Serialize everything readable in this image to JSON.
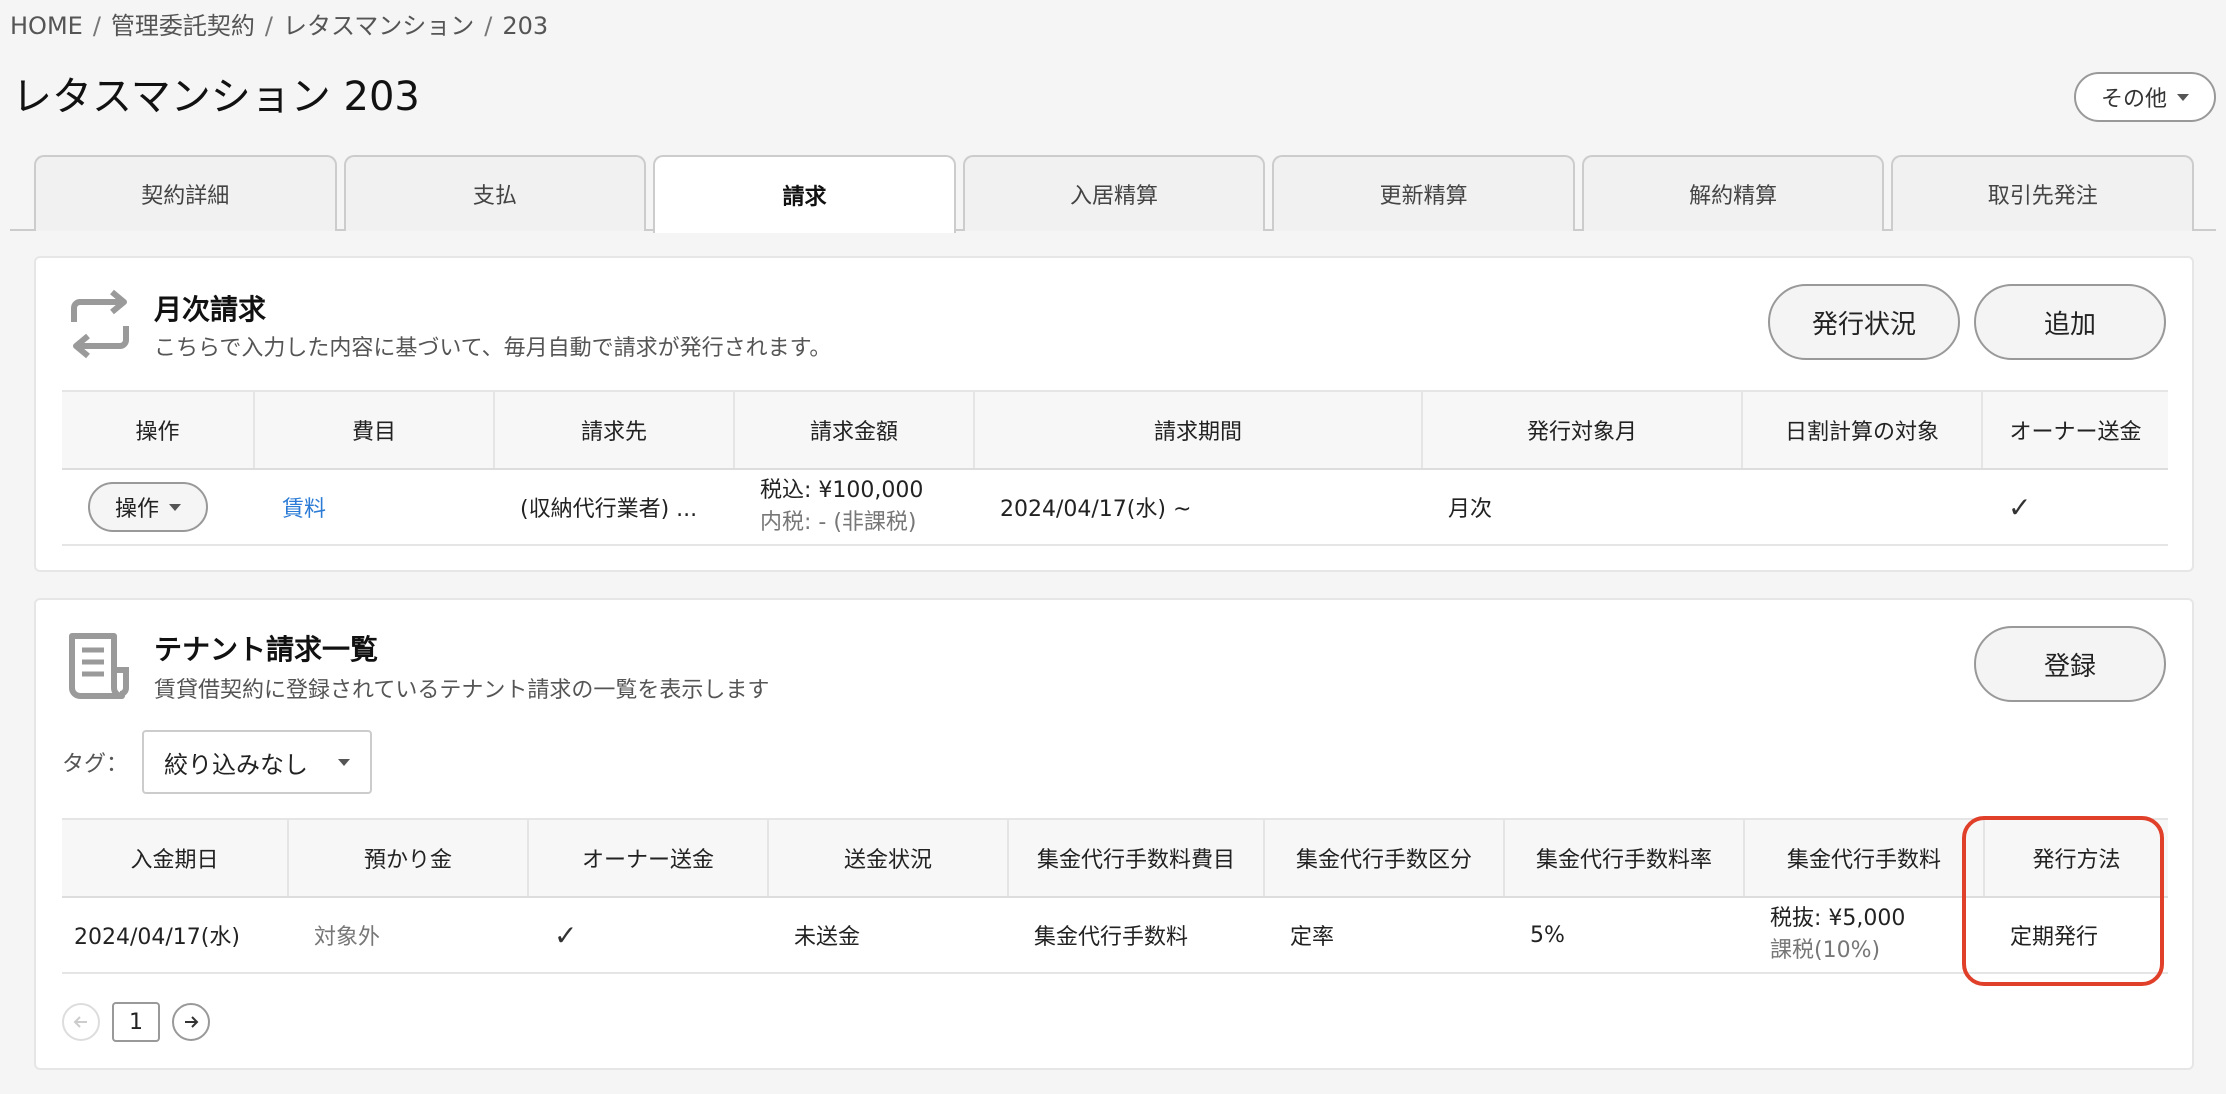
{
  "breadcrumb": {
    "items": [
      "HOME",
      "管理委託契約",
      "レタスマンション",
      "203"
    ],
    "separator": "/"
  },
  "page": {
    "title": "レタスマンション 203",
    "more_button": "その他"
  },
  "tabs": [
    {
      "label": "契約詳細",
      "active": false
    },
    {
      "label": "支払",
      "active": false
    },
    {
      "label": "請求",
      "active": true
    },
    {
      "label": "入居精算",
      "active": false
    },
    {
      "label": "更新精算",
      "active": false
    },
    {
      "label": "解約精算",
      "active": false
    },
    {
      "label": "取引先発注",
      "active": false
    }
  ],
  "monthly": {
    "icon": "repeat-icon",
    "title": "月次請求",
    "description": "こちらで入力した内容に基づいて、毎月自動で請求が発行されます。",
    "status_button": "発行状況",
    "add_button": "追加",
    "columns": [
      "操作",
      "費目",
      "請求先",
      "請求金額",
      "請求期間",
      "発行対象月",
      "日割計算の対象",
      "オーナー送金"
    ],
    "rows": [
      {
        "action": "操作",
        "item": "賃料",
        "billing_to": "(収納代行業者) ...",
        "amount_main": "税込: ¥100,000",
        "amount_sub": "内税: - (非課税)",
        "period": "2024/04/17(水) ~",
        "target_month": "月次",
        "prorated": "",
        "owner_remit": "✓"
      }
    ]
  },
  "tenant": {
    "icon": "document-icon",
    "title": "テナント請求一覧",
    "description": "賃貸借契約に登録されているテナント請求の一覧を表示します",
    "register_button": "登録",
    "tag_label": "タグ：",
    "tag_select": "絞り込みなし",
    "columns": [
      "入金期日",
      "預かり金",
      "オーナー送金",
      "送金状況",
      "集金代行手数料費目",
      "集金代行手数区分",
      "集金代行手数料率",
      "集金代行手数料",
      "発行方法"
    ],
    "rows": [
      {
        "due_date": "2024/04/17(水)",
        "deposit": "対象外",
        "owner_remit": "✓",
        "remit_status": "未送金",
        "fee_item": "集金代行手数料",
        "fee_type": "定率",
        "fee_rate": "5%",
        "fee_main": "税抜: ¥5,000",
        "fee_sub": "課税(10%)",
        "issue_method": "定期発行"
      }
    ],
    "pager": {
      "current": "1"
    }
  },
  "colors": {
    "highlight": "#e0402a",
    "link": "#2b7bd6"
  }
}
